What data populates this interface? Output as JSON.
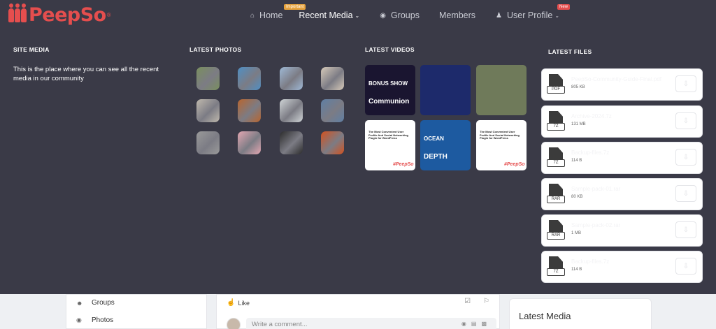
{
  "brand": {
    "name": "PeepSo",
    "mark": "®"
  },
  "nav": {
    "home": {
      "label": "Home",
      "badge": "Important"
    },
    "recent_media": {
      "label": "Recent Media"
    },
    "groups": {
      "label": "Groups"
    },
    "members": {
      "label": "Members"
    },
    "user_profile": {
      "label": "User Profile",
      "badge": "New"
    }
  },
  "mega_menu": {
    "site_media": {
      "title": "SITE MEDIA",
      "description": "This is the place where you can see all the recent media in our community"
    },
    "latest_photos": {
      "title": "LATEST PHOTOS",
      "photos": [
        {
          "name": "building-photo",
          "color": "#7a8f5e"
        },
        {
          "name": "blue-pattern-photo",
          "color": "#4f8fc4"
        },
        {
          "name": "city-towers-photo",
          "color": "#9fb9d6"
        },
        {
          "name": "woman-portrait-photo",
          "color": "#d6c9b9"
        },
        {
          "name": "interior-photo",
          "color": "#bfb8ad"
        },
        {
          "name": "food-photo",
          "color": "#b8652f"
        },
        {
          "name": "lighthouse-photo",
          "color": "#cfd4d6"
        },
        {
          "name": "mountains-photo",
          "color": "#5f7fa4"
        },
        {
          "name": "desk-photo",
          "color": "#9a9a9a"
        },
        {
          "name": "pink-mint-photo",
          "color": "#e3a7b2"
        },
        {
          "name": "dark-figure-photo",
          "color": "#2c2c2c"
        },
        {
          "name": "orange-photo",
          "color": "#d4521f"
        }
      ]
    },
    "latest_videos": {
      "title": "LATEST VIDEOS",
      "videos": [
        {
          "name": "bonus-show-video",
          "caption_top": "BONUS SHOW",
          "caption_bottom": "Communion",
          "color": "#1a1530"
        },
        {
          "name": "space-video",
          "caption_top": "",
          "caption_bottom": "",
          "color": "#1d2a6b"
        },
        {
          "name": "railway-video",
          "caption_top": "",
          "caption_bottom": "",
          "color": "#6f7a5a"
        },
        {
          "name": "peepso-promo-video-1",
          "caption_top": "The Most Convenient User Profile And Social Networking Plugin for WordPress",
          "caption_bottom": "#PeepSo",
          "color": "#ffffff"
        },
        {
          "name": "ocean-depth-video",
          "caption_top": "OCEAN",
          "caption_bottom": "DEPTH",
          "color": "#1d5aa0"
        },
        {
          "name": "peepso-promo-video-2",
          "caption_top": "The Most Convenient User Profile And Social Networking Plugin for WordPress",
          "caption_bottom": "#PeepSo",
          "color": "#ffffff"
        }
      ]
    },
    "latest_files": {
      "title": "LATEST FILES",
      "files": [
        {
          "ext": "PDF",
          "name": "PeepSo-Community-Guide-Final.pdf",
          "size": "805 KB"
        },
        {
          "ext": "7Z",
          "name": "Archive-2024.7z",
          "size": "131 MB"
        },
        {
          "ext": "7Z",
          "name": "Backup-files.7z",
          "size": "114 B"
        },
        {
          "ext": "RAR",
          "name": "Sample-pack-01.rar",
          "size": "80 KB"
        },
        {
          "ext": "RAR",
          "name": "Sample-pack-02.rar",
          "size": "1 MB"
        },
        {
          "ext": "7Z",
          "name": "Backup-files.7z",
          "size": "114 B"
        }
      ]
    }
  },
  "page": {
    "sidebar": {
      "groups": "Groups",
      "photos": "Photos"
    },
    "feed": {
      "like": "Like",
      "comment_placeholder": "Write a comment..."
    },
    "right_panel": {
      "title": "Latest Media"
    }
  },
  "colors": {
    "brand_red": "#e54e4e",
    "header_bg": "#3a3a47",
    "badge_important": "#e7a33e",
    "badge_new": "#e54e4e"
  }
}
